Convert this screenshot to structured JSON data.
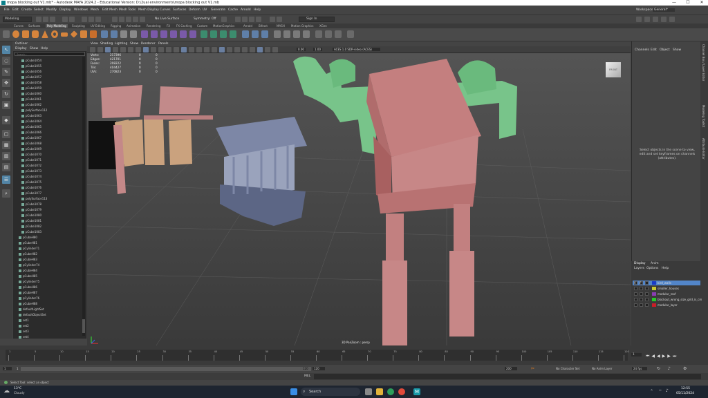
{
  "window": {
    "title": "mopa blocking out V1.mb* - Autodesk MAYA 2024.2 - Educational Version: D:\\2uai environments\\mopa blocking out V1.mb",
    "min": "—",
    "max": "☐",
    "close": "✕"
  },
  "menubar": {
    "items": [
      "File",
      "Edit",
      "Create",
      "Select",
      "Modify",
      "Display",
      "Windows",
      "Mesh",
      "Edit Mesh",
      "Mesh Tools",
      "Mesh Display",
      "Curves",
      "Surfaces",
      "Deform",
      "UV",
      "Generate",
      "Cache",
      "Arnold",
      "Help"
    ],
    "workspace_label": "Workspace:",
    "workspace_value": "General*"
  },
  "statusline": {
    "mode": "Modeling",
    "live": "No Live Surface",
    "symmetry": "Symmetry: Off",
    "signin": "Sign In"
  },
  "shelf": {
    "tabs": [
      "Curves",
      "Surfaces",
      "Poly Modeling",
      "Sculpting",
      "UV Editing",
      "Rigging",
      "Animation",
      "Rendering",
      "FX",
      "FX Caching",
      "Custom",
      "MotionGraphics",
      "Arnold",
      "Bifrost",
      "MASH",
      "Motion Graphics",
      "XGen"
    ],
    "active": "Poly Modeling"
  },
  "outliner": {
    "title": "Outliner",
    "menus": [
      "Display",
      "Show",
      "Help"
    ],
    "search_placeholder": "Search...",
    "items": [
      "pCube1054",
      "pCube1055",
      "pCube1056",
      "pCube1057",
      "pCube1058",
      "pCube1059",
      "pCube1060",
      "pCube1061",
      "pCube1062",
      "polySurface112",
      "pCube1063",
      "pCube1064",
      "pCube1065",
      "pCube1066",
      "pCube1067",
      "pCube1068",
      "pCube1069",
      "pCube1070",
      "pCube1071",
      "pCube1072",
      "pCube1073",
      "pCube1074",
      "pCube1075",
      "pCube1076",
      "pCube1077",
      "polySurface113",
      "pCube1078",
      "pCube1079",
      "pCube1080",
      "pCube1081",
      "pCube1082",
      "pCube1083",
      "pCubeH80",
      "pCubeH81",
      "pCylinder71",
      "pCubeH82",
      "pCubeH83",
      "pCylinder74",
      "pCubeH84",
      "pCubeH85",
      "pCylinder75",
      "pCubeH86",
      "pCubeH87",
      "pCylinder76",
      "pCubeH88",
      "defaultLightSet",
      "defaultObjectSet",
      "set1",
      "set2",
      "set3",
      "set4"
    ]
  },
  "viewport": {
    "menus": [
      "View",
      "Shading",
      "Lighting",
      "Show",
      "Renderer",
      "Panels"
    ],
    "zero": "0.00",
    "one": "1.00",
    "colorspace": "ACES 1.0 SDR-video (ACES)",
    "camera": "3D PanZoom : persp",
    "cube_label": "FRONT",
    "hud": [
      {
        "k": "Verts:",
        "a": "217396",
        "b": "0",
        "c": "0"
      },
      {
        "k": "Edges:",
        "a": "421701",
        "b": "0",
        "c": "0"
      },
      {
        "k": "Faces:",
        "a": "208222",
        "b": "0",
        "c": "0"
      },
      {
        "k": "Tris:",
        "a": "404427",
        "b": "0",
        "c": "0"
      },
      {
        "k": "UVs:",
        "a": "270823",
        "b": "0",
        "c": "0"
      }
    ]
  },
  "channelbox": {
    "menus": [
      "Channels",
      "Edit",
      "Object",
      "Show"
    ],
    "message": "Select objects in the scene to view, edit and set keyframes on channels (attributes)."
  },
  "sidetabs": [
    "Channel Box / Layer Editor",
    "Modeling Toolkit",
    "Attribute Editor"
  ],
  "layers": {
    "tabs": [
      "Display",
      "Anim"
    ],
    "menus": [
      "Layers",
      "Options",
      "Help"
    ],
    "rows": [
      {
        "name": "bird_walls",
        "color": "#1a3cc8",
        "v": "V",
        "p": "P"
      },
      {
        "name": "smaller_houses",
        "color": "#c8c832",
        "v": "",
        "p": ""
      },
      {
        "name": "modular_roof",
        "color": "#8a3cb4",
        "v": "",
        "p": ""
      },
      {
        "name": "blockout_wrong_size_grid_is_cm",
        "color": "#28c828",
        "v": "",
        "p": ""
      },
      {
        "name": "modular_layer",
        "color": "#c81e28",
        "v": "",
        "p": ""
      }
    ]
  },
  "timeslider": {
    "ticks": [
      "1",
      "5",
      "10",
      "15",
      "20",
      "25",
      "30",
      "35",
      "40",
      "45",
      "50",
      "55",
      "60",
      "65",
      "70",
      "75",
      "80",
      "85",
      "90",
      "95",
      "100",
      "105",
      "110",
      "115",
      "120"
    ],
    "current": "1"
  },
  "range": {
    "start": "1",
    "start2": "1",
    "end": "120",
    "end2": "120",
    "end3": "200",
    "character": "No Character Set",
    "anim_layer": "No Anim Layer",
    "fps": "24 fps"
  },
  "cmdline": {
    "label": "MEL"
  },
  "helpline": {
    "text": "Select Tool: select an object"
  },
  "taskbar": {
    "weather_temp": "13°C",
    "weather_desc": "Cloudy",
    "search": "Search",
    "time": "12:55",
    "date": "05/11/2024"
  }
}
